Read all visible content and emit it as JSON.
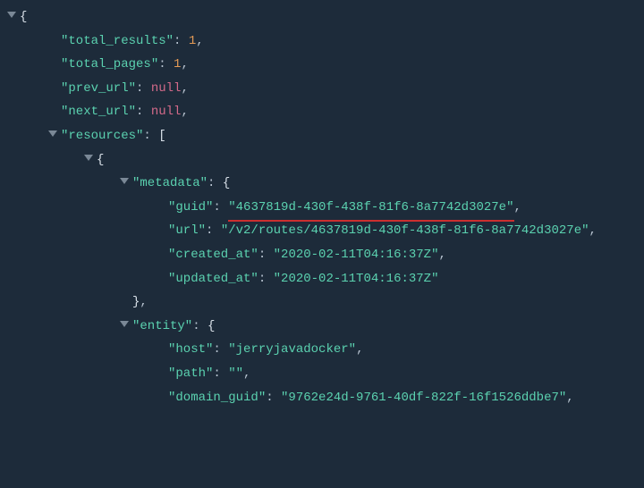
{
  "root_open": "{",
  "keys": {
    "total_results": "\"total_results\"",
    "total_pages": "\"total_pages\"",
    "prev_url": "\"prev_url\"",
    "next_url": "\"next_url\"",
    "resources": "\"resources\"",
    "metadata": "\"metadata\"",
    "guid": "\"guid\"",
    "url": "\"url\"",
    "created_at": "\"created_at\"",
    "updated_at": "\"updated_at\"",
    "entity": "\"entity\"",
    "host": "\"host\"",
    "path": "\"path\"",
    "domain_guid": "\"domain_guid\""
  },
  "vals": {
    "total_results": "1",
    "total_pages": "1",
    "prev_url": "null",
    "next_url": "null",
    "guid": "\"4637819d-430f-438f-81f6-8a7742d3027e\"",
    "url": "\"/v2/routes/4637819d-430f-438f-81f6-8a7742d3027e\"",
    "created_at": "\"2020-02-11T04:16:37Z\"",
    "updated_at": "\"2020-02-11T04:16:37Z\"",
    "host": "\"jerryjavadocker\"",
    "path": "\"\"",
    "domain_guid": "\"9762e24d-9761-40df-822f-16f1526ddbe7\""
  },
  "punct": {
    "colon": ": ",
    "comma": ",",
    "open_obj": "{",
    "close_obj": "}",
    "open_arr": "["
  }
}
